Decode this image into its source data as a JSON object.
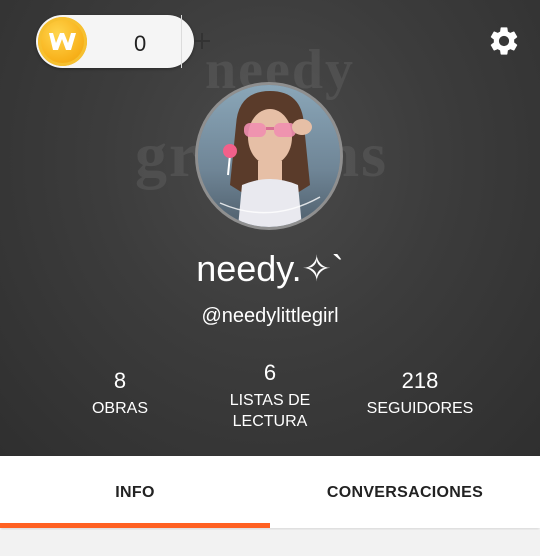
{
  "header": {
    "coin_count": "0",
    "coin_icon": "wattpad-coin-icon",
    "add_icon": "plus-icon",
    "settings_icon": "gear-icon"
  },
  "profile": {
    "display_name": "needy.✧`",
    "username": "@needylittlegirl"
  },
  "stats": {
    "works": {
      "value": "8",
      "label": "OBRAS"
    },
    "reading_lists": {
      "value": "6",
      "label_line1": "LISTAS DE",
      "label_line2": "LECTURA"
    },
    "followers": {
      "value": "218",
      "label": "SEGUIDORES"
    }
  },
  "tabs": [
    {
      "label": "INFO",
      "active": true
    },
    {
      "label": "CONVERSACIONES",
      "active": false
    }
  ],
  "colors": {
    "accent": "#ff6122",
    "coin": "#f8b21c"
  }
}
